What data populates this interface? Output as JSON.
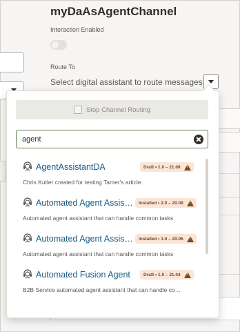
{
  "header": {
    "title": "myDaAsAgentChannel",
    "interaction_label": "Interaction Enabled",
    "route_label": "Route To",
    "route_placeholder": "Select digital assistant to route messages to"
  },
  "popup": {
    "stop_routing_label": "Stop Channel Routing",
    "search_value": "agent",
    "items": [
      {
        "name": "AgentAssistantDA",
        "badge": "Draft • 1.0 – 21.08",
        "description": "Chris Kutler created for testing Tamer's article"
      },
      {
        "name": "Automated Agent Assis…",
        "badge": "Installed • 2.0 – 20.08",
        "description": "Automated agent assistant that can handle common tasks"
      },
      {
        "name": "Automated Agent Assis…",
        "badge": "Installed • 1.0 – 20.06",
        "description": "Automated agent assistant that can handle common tasks"
      },
      {
        "name": "Automated Fusion Agent …",
        "badge": "Draft • 1.0 – 21.04",
        "description": "B2B Service automated agent assistant that can handle co…"
      }
    ]
  },
  "icons": {
    "item_icon": "assistant-headset-icon",
    "badge_icon": "warning-triangle-icon",
    "clear_icon": "clear-circle-icon"
  },
  "colors": {
    "link": "#1d5b83",
    "badge_bg": "#fbe5d6",
    "warning": "#7a4a22",
    "search_border": "#5f7d4f"
  }
}
